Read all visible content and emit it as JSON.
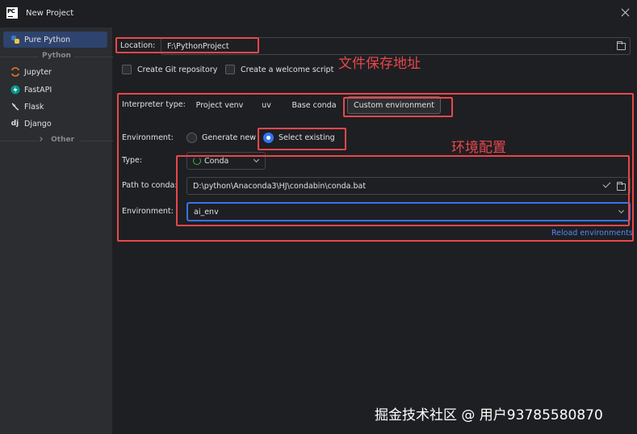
{
  "window": {
    "title": "New Project",
    "logo": "PC"
  },
  "sidebar": {
    "items": [
      {
        "label": "Pure Python",
        "icon": "python-icon"
      },
      {
        "label": "Jupyter",
        "icon": "jupyter-icon"
      },
      {
        "label": "FastAPI",
        "icon": "fastapi-icon"
      },
      {
        "label": "Flask",
        "icon": "flask-icon"
      },
      {
        "label": "Django",
        "icon": "django-icon"
      }
    ],
    "section_python": "Python",
    "section_other": "Other",
    "django_glyph": "dj"
  },
  "location": {
    "label": "Location:",
    "value": "F:\\PythonProject"
  },
  "checkboxes": {
    "git": "Create Git repository",
    "welcome": "Create a welcome script"
  },
  "interpreter": {
    "label": "Interpreter type:",
    "options": [
      "Project venv",
      "uv",
      "Base conda",
      "Custom environment"
    ],
    "selected": "Custom environment"
  },
  "environment_mode": {
    "label": "Environment:",
    "options": [
      "Generate new",
      "Select existing"
    ],
    "selected": "Select existing"
  },
  "type": {
    "label": "Type:",
    "value": "Conda"
  },
  "conda_path": {
    "label": "Path to conda:",
    "value": "D:\\python\\Anaconda3\\HJ\\condabin\\conda.bat"
  },
  "environment": {
    "label": "Environment:",
    "value": "ai_env"
  },
  "reload": {
    "label": "Reload environments"
  },
  "annotations": {
    "save_location": "文件保存地址",
    "env_config": "环境配置"
  },
  "watermark": "掘金技术社区 @ 用户93785580870",
  "colors": {
    "accent": "#3574f0",
    "annotation": "#e8474d",
    "link": "#548af7",
    "background": "#1e1f22",
    "sidebar": "#2b2d30"
  }
}
